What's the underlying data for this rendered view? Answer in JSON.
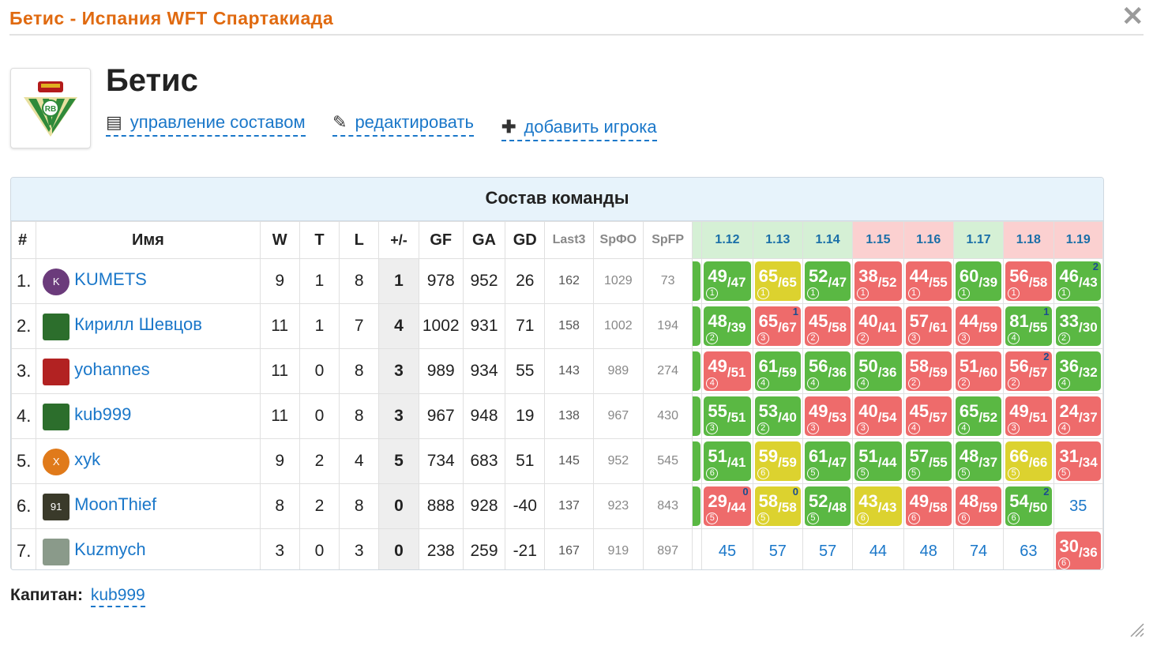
{
  "dialog": {
    "title": "Бетис - Испания WFT Спартакиада",
    "close": "✕"
  },
  "team": {
    "name": "Бетис",
    "actions": [
      {
        "icon": "list-icon",
        "label": "управление составом"
      },
      {
        "icon": "pencil-icon",
        "label": "редактировать"
      },
      {
        "icon": "plus-icon",
        "label": "добавить игрока"
      }
    ]
  },
  "roster": {
    "title": "Состав команды",
    "columns": [
      "#",
      "Имя",
      "W",
      "T",
      "L",
      "+/-",
      "GF",
      "GA",
      "GD",
      "Last3",
      "SpФО",
      "SpFP"
    ],
    "rounds": [
      {
        "label": "1.12",
        "color": "#d5f0d5"
      },
      {
        "label": "1.13",
        "color": "#d5f0d5"
      },
      {
        "label": "1.14",
        "color": "#d5f0d5"
      },
      {
        "label": "1.15",
        "color": "#fbd0d0"
      },
      {
        "label": "1.16",
        "color": "#fbd0d0"
      },
      {
        "label": "1.17",
        "color": "#d5f0d5"
      },
      {
        "label": "1.18",
        "color": "#fbd0d0"
      },
      {
        "label": "1.19",
        "color": "#fbd0d0"
      }
    ],
    "rows": [
      {
        "num": "1.",
        "name": "KUMETS",
        "avatar": "K",
        "avatarColor": "#6b3b7b",
        "captain": "",
        "w": "9",
        "t": "1",
        "l": "8",
        "pm": "1",
        "gf": "978",
        "ga": "952",
        "gd": "26",
        "last3": "162",
        "spfo": "1029",
        "spfp": "73",
        "edgeColor": "#5ab843",
        "games": [
          {
            "s": "49",
            "o": "47",
            "c": "g",
            "t": "1",
            "n": ""
          },
          {
            "s": "65",
            "o": "65",
            "c": "y",
            "t": "1",
            "n": ""
          },
          {
            "s": "52",
            "o": "47",
            "c": "g",
            "t": "1",
            "n": ""
          },
          {
            "s": "38",
            "o": "52",
            "c": "r",
            "t": "1",
            "n": ""
          },
          {
            "s": "44",
            "o": "55",
            "c": "r",
            "t": "1",
            "n": ""
          },
          {
            "s": "60",
            "o": "39",
            "c": "g",
            "t": "1",
            "n": ""
          },
          {
            "s": "56",
            "o": "58",
            "c": "r",
            "t": "1",
            "n": ""
          },
          {
            "s": "46",
            "o": "43",
            "c": "g",
            "t": "1",
            "n": "2"
          }
        ]
      },
      {
        "num": "2.",
        "name": "Кирилл Шевцов",
        "avatar": "",
        "avatarColor": "#2c6e2c",
        "captain": "",
        "w": "11",
        "t": "1",
        "l": "7",
        "pm": "4",
        "gf": "1002",
        "ga": "931",
        "gd": "71",
        "last3": "158",
        "spfo": "1002",
        "spfp": "194",
        "edgeColor": "#5ab843",
        "games": [
          {
            "s": "48",
            "o": "39",
            "c": "g",
            "t": "2",
            "n": ""
          },
          {
            "s": "65",
            "o": "67",
            "c": "r",
            "t": "3",
            "n": "1"
          },
          {
            "s": "45",
            "o": "58",
            "c": "r",
            "t": "2",
            "n": ""
          },
          {
            "s": "40",
            "o": "41",
            "c": "r",
            "t": "2",
            "n": ""
          },
          {
            "s": "57",
            "o": "61",
            "c": "r",
            "t": "3",
            "n": ""
          },
          {
            "s": "44",
            "o": "59",
            "c": "r",
            "t": "3",
            "n": ""
          },
          {
            "s": "81",
            "o": "55",
            "c": "g",
            "t": "4",
            "n": "1"
          },
          {
            "s": "33",
            "o": "30",
            "c": "g",
            "t": "2",
            "n": ""
          }
        ]
      },
      {
        "num": "3.",
        "name": "yohannes",
        "avatar": "",
        "avatarColor": "#b22222",
        "captain": "",
        "w": "11",
        "t": "0",
        "l": "8",
        "pm": "3",
        "gf": "989",
        "ga": "934",
        "gd": "55",
        "last3": "143",
        "spfo": "989",
        "spfp": "274",
        "edgeColor": "#5ab843",
        "games": [
          {
            "s": "49",
            "o": "51",
            "c": "r",
            "t": "4",
            "n": ""
          },
          {
            "s": "61",
            "o": "59",
            "c": "g",
            "t": "4",
            "n": ""
          },
          {
            "s": "56",
            "o": "36",
            "c": "g",
            "t": "4",
            "n": ""
          },
          {
            "s": "50",
            "o": "36",
            "c": "g",
            "t": "4",
            "n": ""
          },
          {
            "s": "58",
            "o": "59",
            "c": "r",
            "t": "2",
            "n": ""
          },
          {
            "s": "51",
            "o": "60",
            "c": "r",
            "t": "2",
            "n": ""
          },
          {
            "s": "56",
            "o": "57",
            "c": "r",
            "t": "2",
            "n": "2"
          },
          {
            "s": "36",
            "o": "32",
            "c": "g",
            "t": "4",
            "n": ""
          }
        ]
      },
      {
        "num": "4.",
        "name": "kub999",
        "avatar": "",
        "avatarColor": "#2c6e2c",
        "captain": "C",
        "w": "11",
        "t": "0",
        "l": "8",
        "pm": "3",
        "gf": "967",
        "ga": "948",
        "gd": "19",
        "last3": "138",
        "spfo": "967",
        "spfp": "430",
        "edgeColor": "#5ab843",
        "games": [
          {
            "s": "55",
            "o": "51",
            "c": "g",
            "t": "3",
            "n": ""
          },
          {
            "s": "53",
            "o": "40",
            "c": "g",
            "t": "2",
            "n": ""
          },
          {
            "s": "49",
            "o": "53",
            "c": "r",
            "t": "3",
            "n": ""
          },
          {
            "s": "40",
            "o": "54",
            "c": "r",
            "t": "3",
            "n": ""
          },
          {
            "s": "45",
            "o": "57",
            "c": "r",
            "t": "4",
            "n": ""
          },
          {
            "s": "65",
            "o": "52",
            "c": "g",
            "t": "4",
            "n": ""
          },
          {
            "s": "49",
            "o": "51",
            "c": "r",
            "t": "3",
            "n": ""
          },
          {
            "s": "24",
            "o": "37",
            "c": "r",
            "t": "4",
            "n": ""
          }
        ]
      },
      {
        "num": "5.",
        "name": "xyk",
        "avatar": "X",
        "avatarColor": "#e07a1a",
        "captain": "",
        "w": "9",
        "t": "2",
        "l": "4",
        "pm": "5",
        "gf": "734",
        "ga": "683",
        "gd": "51",
        "last3": "145",
        "spfo": "952",
        "spfp": "545",
        "edgeColor": "#5ab843",
        "games": [
          {
            "s": "51",
            "o": "41",
            "c": "g",
            "t": "6",
            "n": ""
          },
          {
            "s": "59",
            "o": "59",
            "c": "y",
            "t": "6",
            "n": ""
          },
          {
            "s": "61",
            "o": "47",
            "c": "g",
            "t": "5",
            "n": ""
          },
          {
            "s": "51",
            "o": "44",
            "c": "g",
            "t": "5",
            "n": ""
          },
          {
            "s": "57",
            "o": "55",
            "c": "g",
            "t": "5",
            "n": ""
          },
          {
            "s": "48",
            "o": "37",
            "c": "g",
            "t": "5",
            "n": ""
          },
          {
            "s": "66",
            "o": "66",
            "c": "y",
            "t": "5",
            "n": ""
          },
          {
            "s": "31",
            "o": "34",
            "c": "r",
            "t": "5",
            "n": ""
          }
        ]
      },
      {
        "num": "6.",
        "name": "MoonThief",
        "avatar": "91",
        "avatarColor": "#3a3a2a",
        "captain": "",
        "w": "8",
        "t": "2",
        "l": "8",
        "pm": "0",
        "gf": "888",
        "ga": "928",
        "gd": "-40",
        "last3": "137",
        "spfo": "923",
        "spfp": "843",
        "edgeColor": "#5ab843",
        "games": [
          {
            "s": "29",
            "o": "44",
            "c": "r",
            "t": "5",
            "n": "0"
          },
          {
            "s": "58",
            "o": "58",
            "c": "y",
            "t": "5",
            "n": "0"
          },
          {
            "s": "52",
            "o": "48",
            "c": "g",
            "t": "5",
            "n": ""
          },
          {
            "s": "43",
            "o": "43",
            "c": "y",
            "t": "6",
            "n": ""
          },
          {
            "s": "49",
            "o": "58",
            "c": "r",
            "t": "6",
            "n": ""
          },
          {
            "s": "48",
            "o": "59",
            "c": "r",
            "t": "6",
            "n": ""
          },
          {
            "s": "54",
            "o": "50",
            "c": "g",
            "t": "6",
            "n": "2"
          },
          {
            "plain": "35"
          }
        ]
      },
      {
        "num": "7.",
        "name": "Kuzmych",
        "avatar": "",
        "avatarColor": "#8a9a8a",
        "captain": "",
        "w": "3",
        "t": "0",
        "l": "3",
        "pm": "0",
        "gf": "238",
        "ga": "259",
        "gd": "-21",
        "last3": "167",
        "spfo": "919",
        "spfp": "897",
        "edgeColor": "",
        "games": [
          {
            "plain": "45"
          },
          {
            "plain": "57"
          },
          {
            "plain": "57"
          },
          {
            "plain": "44"
          },
          {
            "plain": "48"
          },
          {
            "plain": "74"
          },
          {
            "plain": "63"
          },
          {
            "s": "30",
            "o": "36",
            "c": "r",
            "t": "6",
            "n": ""
          }
        ]
      }
    ]
  },
  "captain": {
    "label": "Капитан:",
    "name": "kub999"
  }
}
